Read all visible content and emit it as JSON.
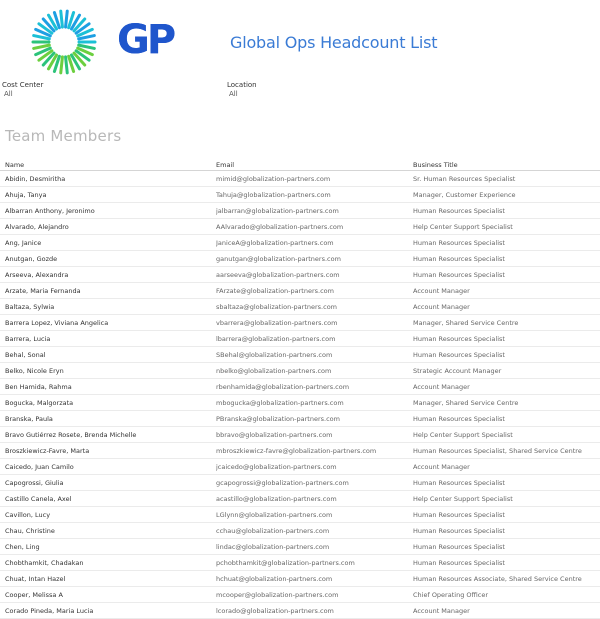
{
  "brand": {
    "letters": "GP",
    "accent": "#3a7bd5"
  },
  "header": {
    "title": "Global Ops Headcount List"
  },
  "filters": [
    {
      "label": "Cost Center",
      "value": "All"
    },
    {
      "label": "Location",
      "value": "All"
    }
  ],
  "section": {
    "title": "Team Members"
  },
  "table": {
    "columns": [
      "Name",
      "Email",
      "Business Title"
    ],
    "rows": [
      [
        "Abidin, Desmiritha",
        "mimid@globalization-partners.com",
        "Sr. Human Resources Specialist"
      ],
      [
        "Ahuja, Tanya",
        "Tahuja@globalization-partners.com",
        "Manager, Customer Experience"
      ],
      [
        "Albarran Anthony, Jeronimo",
        "jalbarran@globalization-partners.com",
        "Human Resources Specialist"
      ],
      [
        "Alvarado, Alejandro",
        "AAlvarado@globalization-partners.com",
        "Help Center Support Specialist"
      ],
      [
        "Ang, Janice",
        "JaniceA@globalization-partners.com",
        "Human Resources Specialist"
      ],
      [
        "Anutgan, Gozde",
        "ganutgan@globalization-partners.com",
        "Human Resources Specialist"
      ],
      [
        "Arseeva, Alexandra",
        "aarseeva@globalization-partners.com",
        "Human Resources Specialist"
      ],
      [
        "Arzate, Maria Fernanda",
        "FArzate@globalization-partners.com",
        "Account Manager"
      ],
      [
        "Baltaza, Sylwia",
        "sbaltaza@globalization-partners.com",
        "Account Manager"
      ],
      [
        "Barrera Lopez, Viviana Angelica",
        "vbarrera@globalization-partners.com",
        "Manager, Shared Service Centre"
      ],
      [
        "Barrera, Lucia",
        "lbarrera@globalization-partners.com",
        "Human Resources Specialist"
      ],
      [
        "Behal, Sonal",
        "SBehal@globalization-partners.com",
        "Human Resources Specialist"
      ],
      [
        "Belko, Nicole Eryn",
        "nbelko@globalization-partners.com",
        "Strategic Account Manager"
      ],
      [
        "Ben Hamida, Rahma",
        "rbenhamida@globalization-partners.com",
        "Account Manager"
      ],
      [
        "Bogucka, Malgorzata",
        "mbogucka@globalization-partners.com",
        "Manager, Shared Service Centre"
      ],
      [
        "Branska, Paula",
        "PBranska@globalization-partners.com",
        "Human Resources Specialist"
      ],
      [
        "Bravo Gutiérrez Rosete, Brenda Michelle",
        "bbravo@globalization-partners.com",
        "Help Center Support Specialist"
      ],
      [
        "Broszkiewicz-Favre, Marta",
        "mbroszkiewicz-favre@globalization-partners.com",
        "Human Resources Specialist, Shared Service Centre"
      ],
      [
        "Caicedo, Juan Camilo",
        "jcaicedo@globalization-partners.com",
        "Account Manager"
      ],
      [
        "Capogrossi, Giulia",
        "gcapogrossi@globalization-partners.com",
        "Human Resources Specialist"
      ],
      [
        "Castillo Canela, Axel",
        "acastillo@globalization-partners.com",
        "Help Center Support Specialist"
      ],
      [
        "Cavillon, Lucy",
        "LGlynn@globalization-partners.com",
        "Human Resources Specialist"
      ],
      [
        "Chau, Christine",
        "cchau@globalization-partners.com",
        "Human Resources Specialist"
      ],
      [
        "Chen, Ling",
        "lindac@globalization-partners.com",
        "Human Resources Specialist"
      ],
      [
        "Chobthamkit, Chadakan",
        "pchobthamkit@globalization-partners.com",
        "Human Resources Specialist"
      ],
      [
        "Chuat, Intan Hazel",
        "hchuat@globalization-partners.com",
        "Human Resources Associate, Shared Service Centre"
      ],
      [
        "Cooper, Melissa A",
        "mcooper@globalization-partners.com",
        "Chief Operating Officer"
      ],
      [
        "Corado Pineda, Maria Lucia",
        "lcorado@globalization-partners.com",
        "Account Manager"
      ]
    ]
  }
}
